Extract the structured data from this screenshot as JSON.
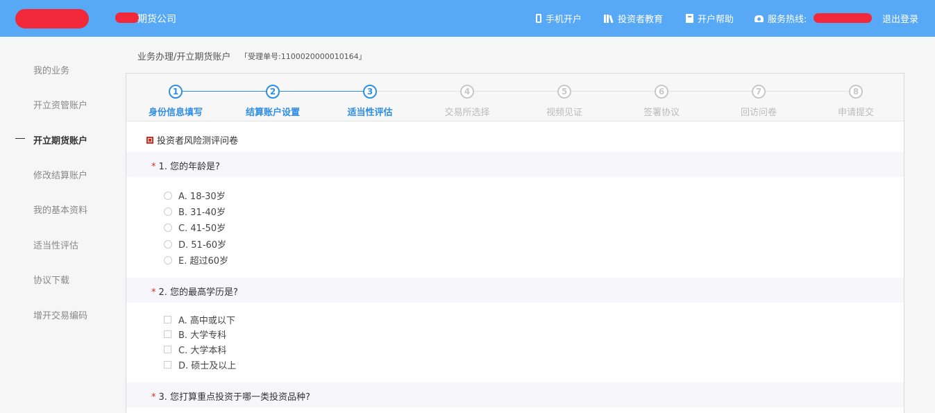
{
  "header": {
    "company_name": "期货公司",
    "nav": [
      {
        "label": "手机开户",
        "icon": "mobile-icon"
      },
      {
        "label": "投资者教育",
        "icon": "books-icon"
      },
      {
        "label": "开户帮助",
        "icon": "book-icon"
      },
      {
        "label": "服务热线:",
        "icon": "telephone-icon"
      }
    ],
    "logout": "退出登录"
  },
  "sidebar": {
    "items": [
      {
        "label": "我的业务"
      },
      {
        "label": "开立资管账户"
      },
      {
        "label": "开立期货账户",
        "active": true
      },
      {
        "label": "修改结算账户"
      },
      {
        "label": "我的基本资料"
      },
      {
        "label": "适当性评估"
      },
      {
        "label": "协议下载"
      },
      {
        "label": "增开交易编码"
      }
    ]
  },
  "breadcrumb": {
    "path": "业务办理/开立期货账户",
    "receipt": "「受理单号:1100020000010164」"
  },
  "steps": [
    {
      "num": "1",
      "label": "身份信息填写",
      "done": true
    },
    {
      "num": "2",
      "label": "结算账户设置",
      "done": true
    },
    {
      "num": "3",
      "label": "适当性评估",
      "done": true
    },
    {
      "num": "4",
      "label": "交易所选择",
      "done": false
    },
    {
      "num": "5",
      "label": "视频见证",
      "done": false
    },
    {
      "num": "6",
      "label": "签署协议",
      "done": false
    },
    {
      "num": "7",
      "label": "回访问卷",
      "done": false
    },
    {
      "num": "8",
      "label": "申请提交",
      "done": false
    }
  ],
  "questionnaire": {
    "title": "投资者风险测评问卷",
    "required_mark": "*",
    "questions": [
      {
        "text": "1. 您的年龄是?",
        "type": "radio",
        "options": [
          "A. 18-30岁",
          "B. 31-40岁",
          "C. 41-50岁",
          "D. 51-60岁",
          "E. 超过60岁"
        ]
      },
      {
        "text": "2. 您的最高学历是?",
        "type": "checkbox",
        "options": [
          "A. 高中或以下",
          "B. 大学专科",
          "C. 大学本科",
          "D. 硕士及以上"
        ]
      },
      {
        "text": "3. 您打算重点投资于哪一类投资品种?",
        "type": "radio",
        "options": []
      }
    ]
  },
  "colors": {
    "header_bg": "#58a9f5",
    "step_done": "#2e8de5",
    "step_pending": "#c8c8c8",
    "required": "#e0281f"
  }
}
